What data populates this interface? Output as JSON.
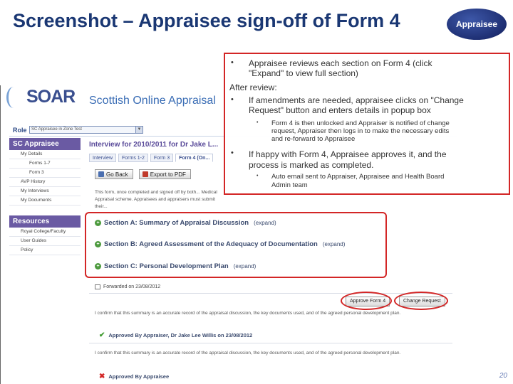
{
  "slide": {
    "title": "Screenshot – Appraisee sign-off of Form 4",
    "role_badge": "Appraisee",
    "page_number": "20"
  },
  "app": {
    "logo": "SOAR",
    "subtitle": "Scottish Online Appraisal",
    "role_label": "Role",
    "role_value": "SC Appraisee in Zone Test"
  },
  "sidebar": {
    "header": "SC Appraisee",
    "items": [
      "My Details",
      "Forms 1-7",
      "Form 3",
      "AVP History",
      "My Interviews",
      "My Documents"
    ],
    "resources_header": "Resources",
    "resources": [
      "Royal College/Faculty",
      "User Guides",
      "Policy"
    ]
  },
  "main": {
    "title": "Interview for 2010/2011 for Dr Jake L...",
    "tabs": [
      "Interview",
      "Forms 1-2",
      "Form 3",
      "Form 4 (On..."
    ],
    "back_button": "Go Back",
    "export_button": "Export to PDF",
    "intro_text": "This form, once completed and signed off by both... Medical Appraisal scheme. Appraisees and appraisers must submit their...",
    "sections": [
      {
        "label": "Section A: Summary of Appraisal Discussion",
        "expand": "(expand)"
      },
      {
        "label": "Section B: Agreed Assessment of the Adequacy of Documentation",
        "expand": "(expand)"
      },
      {
        "label": "Section C: Personal Development Plan",
        "expand": "(expand)"
      }
    ],
    "forwarded": "Forwarded on 23/08/2012",
    "approve_button": "Approve Form 4",
    "change_request_button": "Change Request",
    "confirm_text": "I confirm that this summary is an accurate record of the appraisal discussion, the key documents used, and of the agreed personal development plan.",
    "approved_appraiser": "Approved By Appraiser, Dr Jake Lee Willis on 23/08/2012",
    "approved_appraisee": "Approved By Appraisee"
  },
  "callout": {
    "b1_line1": "Appraisee reviews each section on Form 4 (click",
    "b1_line2": "\"Expand\" to view full section)",
    "after_review": "After review:",
    "b2_line1": "If amendments are needed, appraisee clicks on \"Change",
    "b2_line2": "Request\" button and enters details in popup box",
    "b2a_line1": "Form 4 is then unlocked and Appraiser is notified of change",
    "b2a_line2": "request, Appraiser then logs in to make the necessary edits",
    "b2a_line3": "and re-forward to Appraisee",
    "b3_line1": "If happy with Form 4, Appraisee approves it, and the",
    "b3_line2": "process is marked as completed.",
    "b3a_line1": "Auto email sent to Appraiser, Appraisee and Health Board",
    "b3a_line2": "Admin team"
  }
}
